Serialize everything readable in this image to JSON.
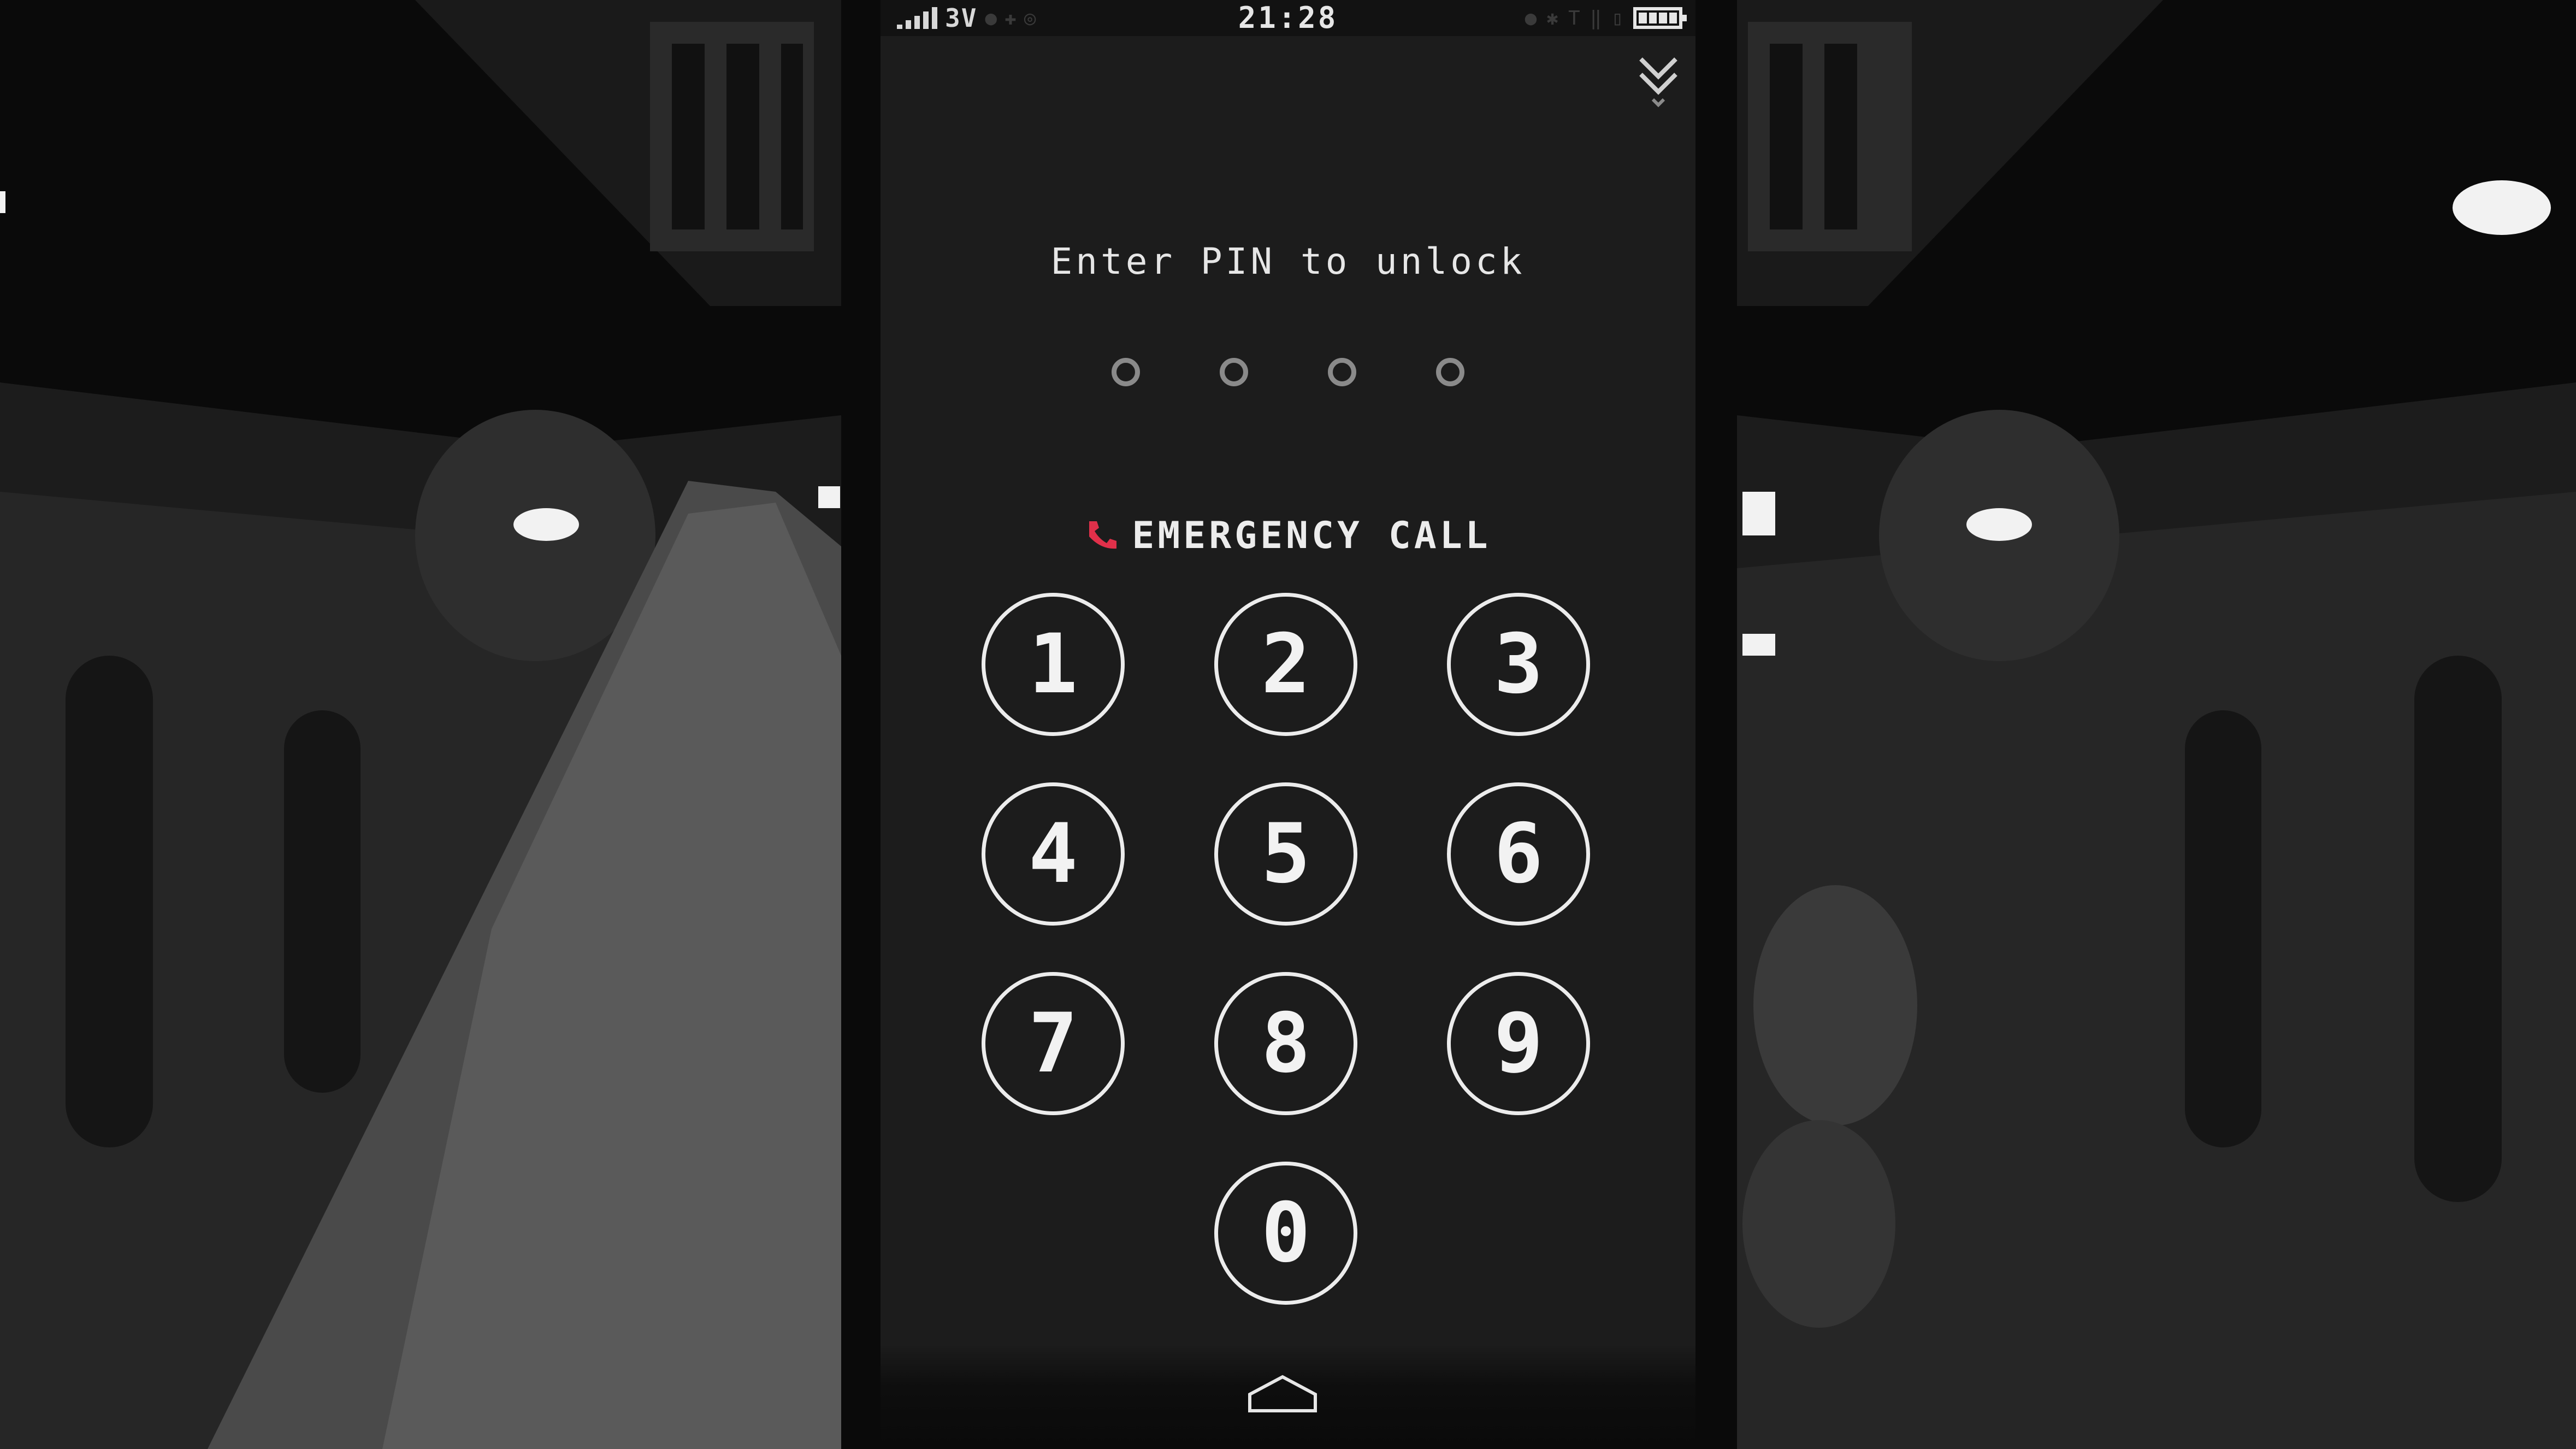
{
  "status_bar": {
    "network": "3V",
    "time": "21:28"
  },
  "lock_screen": {
    "prompt": "Enter PIN to unlock",
    "pin_length": 4,
    "pin_entered": 0,
    "emergency_call_label": "EMERGENCY CALL",
    "emergency_icon": "phone-icon",
    "keypad": [
      "1",
      "2",
      "3",
      "4",
      "5",
      "6",
      "7",
      "8",
      "9",
      "0"
    ]
  },
  "colors": {
    "emergency_icon": "#e0304a",
    "text": "#ececec"
  },
  "icons": [
    "signal-icon",
    "battery-icon",
    "collapse-chevron-icon",
    "home-icon"
  ]
}
